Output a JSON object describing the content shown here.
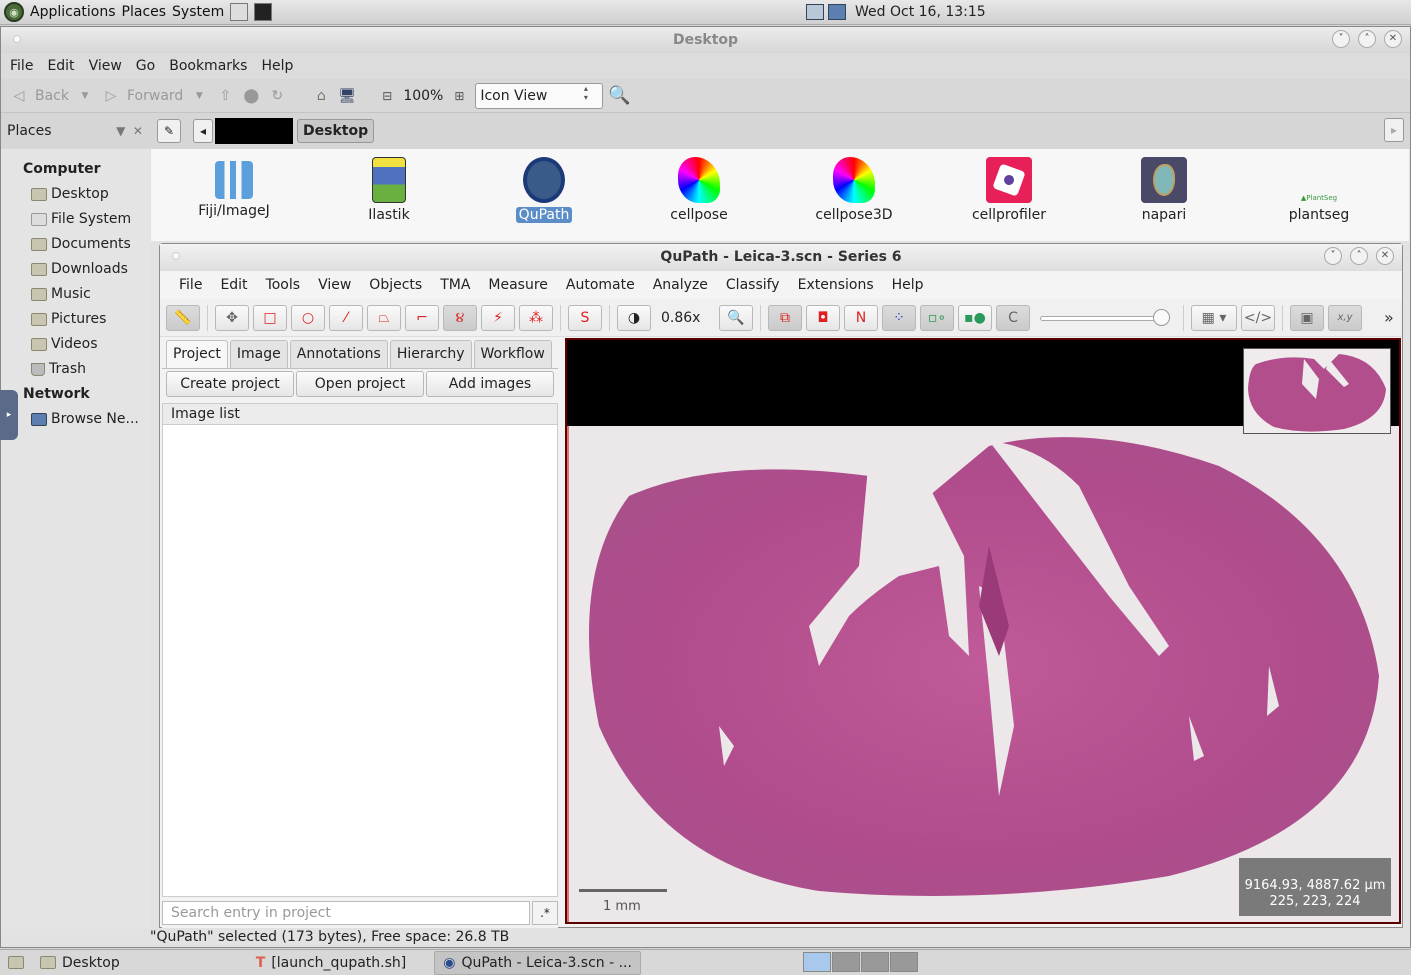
{
  "top_panel": {
    "menus": [
      "Applications",
      "Places",
      "System"
    ],
    "clock": "Wed Oct 16, 13:15"
  },
  "file_manager": {
    "title": "Desktop",
    "menus": [
      "File",
      "Edit",
      "View",
      "Go",
      "Bookmarks",
      "Help"
    ],
    "toolbar": {
      "back": "Back",
      "forward": "Forward",
      "zoom": "100%",
      "view_mode": "Icon View"
    },
    "places_label": "Places",
    "location": "Desktop",
    "sidebar": {
      "computer_header": "Computer",
      "computer_items": [
        "Desktop",
        "File System",
        "Documents",
        "Downloads",
        "Music",
        "Pictures",
        "Videos",
        "Trash"
      ],
      "network_header": "Network",
      "network_items": [
        "Browse Ne..."
      ]
    },
    "icons": [
      {
        "label": "Fiji/ImageJ",
        "selected": false
      },
      {
        "label": "Ilastik",
        "selected": false
      },
      {
        "label": "QuPath",
        "selected": true
      },
      {
        "label": "cellpose",
        "selected": false
      },
      {
        "label": "cellpose3D",
        "selected": false
      },
      {
        "label": "cellprofiler",
        "selected": false
      },
      {
        "label": "napari",
        "selected": false
      },
      {
        "label": "plantseg",
        "selected": false
      }
    ],
    "status": "\"QuPath\" selected (173 bytes), Free space: 26.8 TB"
  },
  "qupath": {
    "title": "QuPath - Leica-3.scn - Series 6",
    "menus": [
      "File",
      "Edit",
      "Tools",
      "View",
      "Objects",
      "TMA",
      "Measure",
      "Automate",
      "Analyze",
      "Classify",
      "Extensions",
      "Help"
    ],
    "toolbar": {
      "zoom": "0.86x",
      "selection_mode_label": "S",
      "names_label": "N",
      "convex_label": "C",
      "xy_label": "x,y",
      "more": "»",
      "opacity_slider": 1.0
    },
    "tabs": [
      "Project",
      "Image",
      "Annotations",
      "Hierarchy",
      "Workflow"
    ],
    "active_tab": "Project",
    "project_buttons": [
      "Create project",
      "Open project",
      "Add images"
    ],
    "image_list_header": "Image list",
    "search_placeholder": "Search entry in project",
    "regex_button": ".*",
    "viewer": {
      "scalebar_label": "1 mm",
      "cursor_position": "9164.93, 4887.62 µm",
      "pixel_value": "225, 223, 224"
    }
  },
  "taskbar": {
    "items": [
      "Desktop",
      "[launch_qupath.sh]",
      "QuPath - Leica-3.scn - ..."
    ],
    "workspaces": 4,
    "active_workspace": 1
  }
}
